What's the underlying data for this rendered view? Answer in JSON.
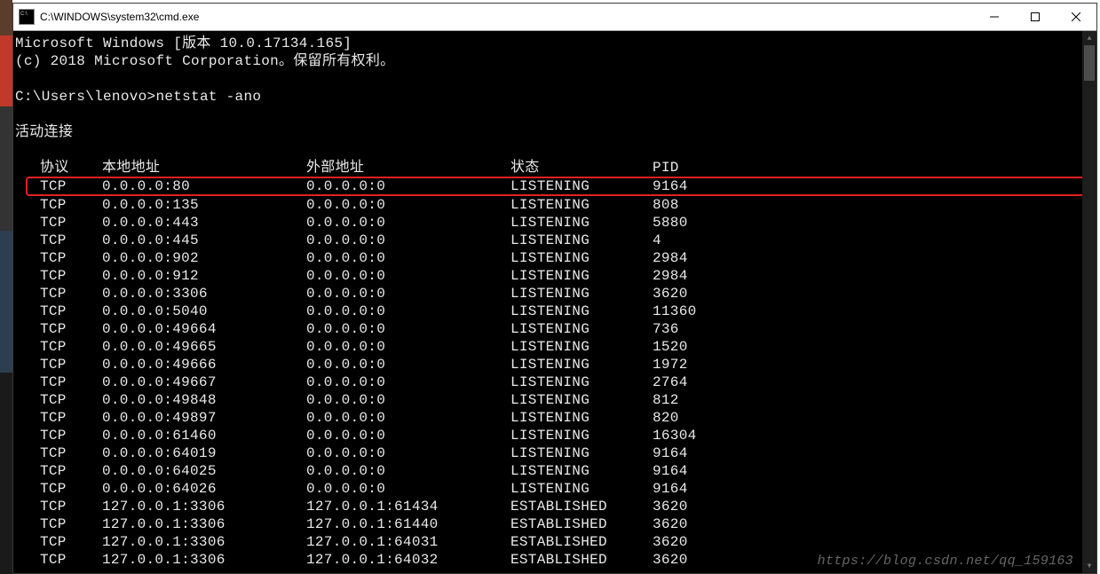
{
  "window": {
    "title": "C:\\WINDOWS\\system32\\cmd.exe"
  },
  "header": {
    "line1": "Microsoft Windows [版本 10.0.17134.165]",
    "line2": "(c) 2018 Microsoft Corporation。保留所有权利。"
  },
  "prompt": {
    "path": "C:\\Users\\lenovo>",
    "command": "netstat -ano"
  },
  "section_title": "活动连接",
  "columns": {
    "proto": "协议",
    "local": "本地地址",
    "foreign": "外部地址",
    "state": "状态",
    "pid": "PID"
  },
  "rows": [
    {
      "proto": "TCP",
      "local": "0.0.0.0:80",
      "foreign": "0.0.0.0:0",
      "state": "LISTENING",
      "pid": "9164",
      "hl": true
    },
    {
      "proto": "TCP",
      "local": "0.0.0.0:135",
      "foreign": "0.0.0.0:0",
      "state": "LISTENING",
      "pid": "808"
    },
    {
      "proto": "TCP",
      "local": "0.0.0.0:443",
      "foreign": "0.0.0.0:0",
      "state": "LISTENING",
      "pid": "5880"
    },
    {
      "proto": "TCP",
      "local": "0.0.0.0:445",
      "foreign": "0.0.0.0:0",
      "state": "LISTENING",
      "pid": "4"
    },
    {
      "proto": "TCP",
      "local": "0.0.0.0:902",
      "foreign": "0.0.0.0:0",
      "state": "LISTENING",
      "pid": "2984"
    },
    {
      "proto": "TCP",
      "local": "0.0.0.0:912",
      "foreign": "0.0.0.0:0",
      "state": "LISTENING",
      "pid": "2984"
    },
    {
      "proto": "TCP",
      "local": "0.0.0.0:3306",
      "foreign": "0.0.0.0:0",
      "state": "LISTENING",
      "pid": "3620"
    },
    {
      "proto": "TCP",
      "local": "0.0.0.0:5040",
      "foreign": "0.0.0.0:0",
      "state": "LISTENING",
      "pid": "11360"
    },
    {
      "proto": "TCP",
      "local": "0.0.0.0:49664",
      "foreign": "0.0.0.0:0",
      "state": "LISTENING",
      "pid": "736"
    },
    {
      "proto": "TCP",
      "local": "0.0.0.0:49665",
      "foreign": "0.0.0.0:0",
      "state": "LISTENING",
      "pid": "1520"
    },
    {
      "proto": "TCP",
      "local": "0.0.0.0:49666",
      "foreign": "0.0.0.0:0",
      "state": "LISTENING",
      "pid": "1972"
    },
    {
      "proto": "TCP",
      "local": "0.0.0.0:49667",
      "foreign": "0.0.0.0:0",
      "state": "LISTENING",
      "pid": "2764"
    },
    {
      "proto": "TCP",
      "local": "0.0.0.0:49848",
      "foreign": "0.0.0.0:0",
      "state": "LISTENING",
      "pid": "812"
    },
    {
      "proto": "TCP",
      "local": "0.0.0.0:49897",
      "foreign": "0.0.0.0:0",
      "state": "LISTENING",
      "pid": "820"
    },
    {
      "proto": "TCP",
      "local": "0.0.0.0:61460",
      "foreign": "0.0.0.0:0",
      "state": "LISTENING",
      "pid": "16304"
    },
    {
      "proto": "TCP",
      "local": "0.0.0.0:64019",
      "foreign": "0.0.0.0:0",
      "state": "LISTENING",
      "pid": "9164"
    },
    {
      "proto": "TCP",
      "local": "0.0.0.0:64025",
      "foreign": "0.0.0.0:0",
      "state": "LISTENING",
      "pid": "9164"
    },
    {
      "proto": "TCP",
      "local": "0.0.0.0:64026",
      "foreign": "0.0.0.0:0",
      "state": "LISTENING",
      "pid": "9164"
    },
    {
      "proto": "TCP",
      "local": "127.0.0.1:3306",
      "foreign": "127.0.0.1:61434",
      "state": "ESTABLISHED",
      "pid": "3620"
    },
    {
      "proto": "TCP",
      "local": "127.0.0.1:3306",
      "foreign": "127.0.0.1:61440",
      "state": "ESTABLISHED",
      "pid": "3620"
    },
    {
      "proto": "TCP",
      "local": "127.0.0.1:3306",
      "foreign": "127.0.0.1:64031",
      "state": "ESTABLISHED",
      "pid": "3620"
    },
    {
      "proto": "TCP",
      "local": "127.0.0.1:3306",
      "foreign": "127.0.0.1:64032",
      "state": "ESTABLISHED",
      "pid": "3620"
    }
  ],
  "watermark": "https://blog.csdn.net/qq_159163"
}
